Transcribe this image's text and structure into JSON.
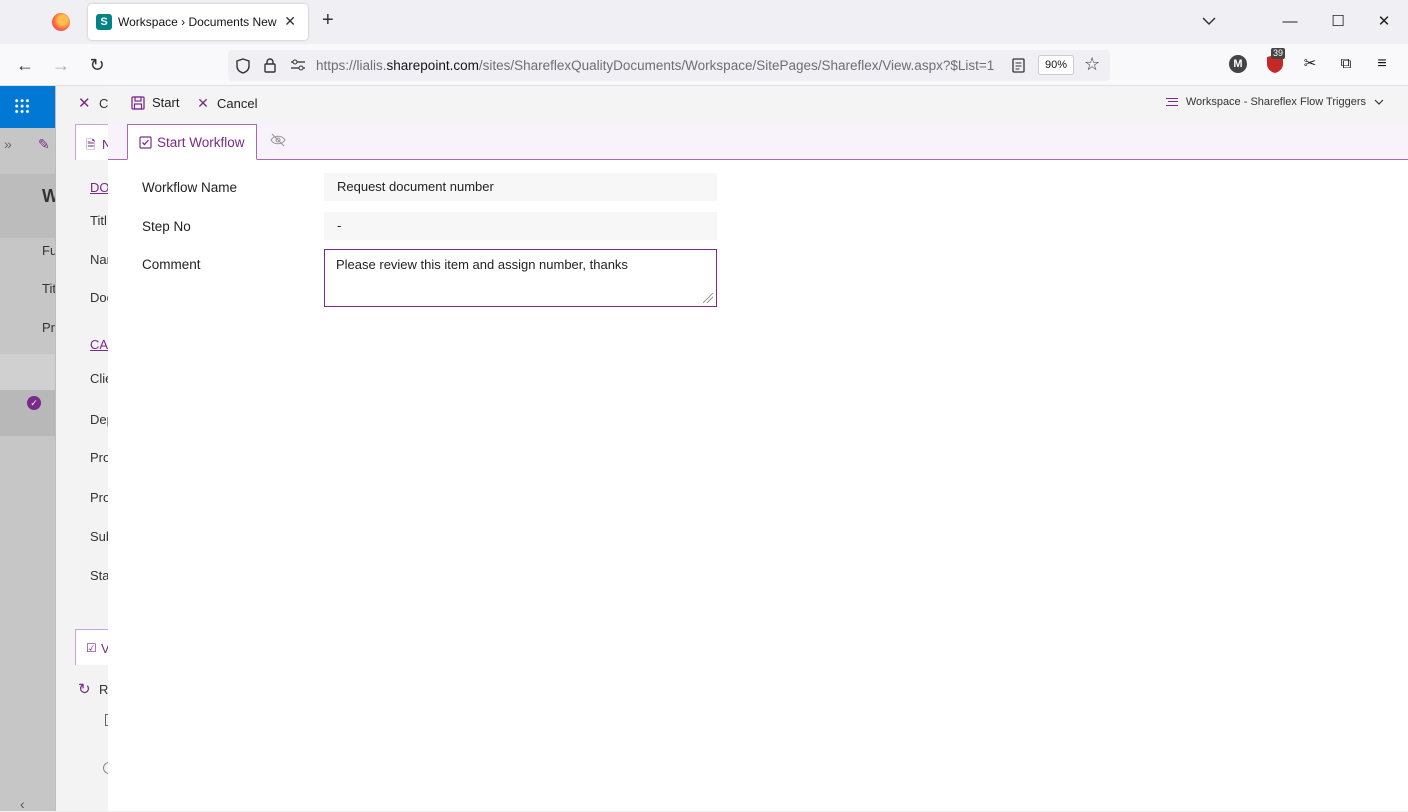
{
  "browser": {
    "tab_title": "Workspace › Documents New",
    "tab_favicon": "S",
    "url_prefix": "https://lialis.",
    "url_domain": "sharepoint.com",
    "url_path": "/sites/ShareflexQualityDocuments/Workspace/SitePages/Shareflex/View.aspx?$List=1",
    "zoom": "90%",
    "ext_badge": "39",
    "ext_profile_initial": "M"
  },
  "background_page": {
    "cmd_initial": "C",
    "tab_initial": "N",
    "page_initial": "W",
    "left_labels": [
      "Fu",
      "Tit",
      "Pr"
    ],
    "section_doc": "DO",
    "section_cat": "CA",
    "field_labels": [
      "Titl",
      "Nar",
      "Doc",
      "Clie",
      "Dep",
      "Pro",
      "Pro",
      "Sub",
      "Sta"
    ],
    "wf_tab_initial": "V",
    "refresh_initial": "R"
  },
  "panel": {
    "commands": {
      "start": "Start",
      "cancel": "Cancel"
    },
    "breadcrumb": "Workspace - Shareflex Flow Triggers",
    "tab_label": "Start Workflow",
    "fields": {
      "workflow_name_label": "Workflow Name",
      "workflow_name_value": "Request document number",
      "step_no_label": "Step No",
      "step_no_value": "-",
      "comment_label": "Comment",
      "comment_value": "Please review this item and assign number, thanks"
    }
  },
  "colors": {
    "accent": "#7a2a8a",
    "sharepoint_blue": "#0078d4",
    "tab_border": "#a86ab8"
  }
}
